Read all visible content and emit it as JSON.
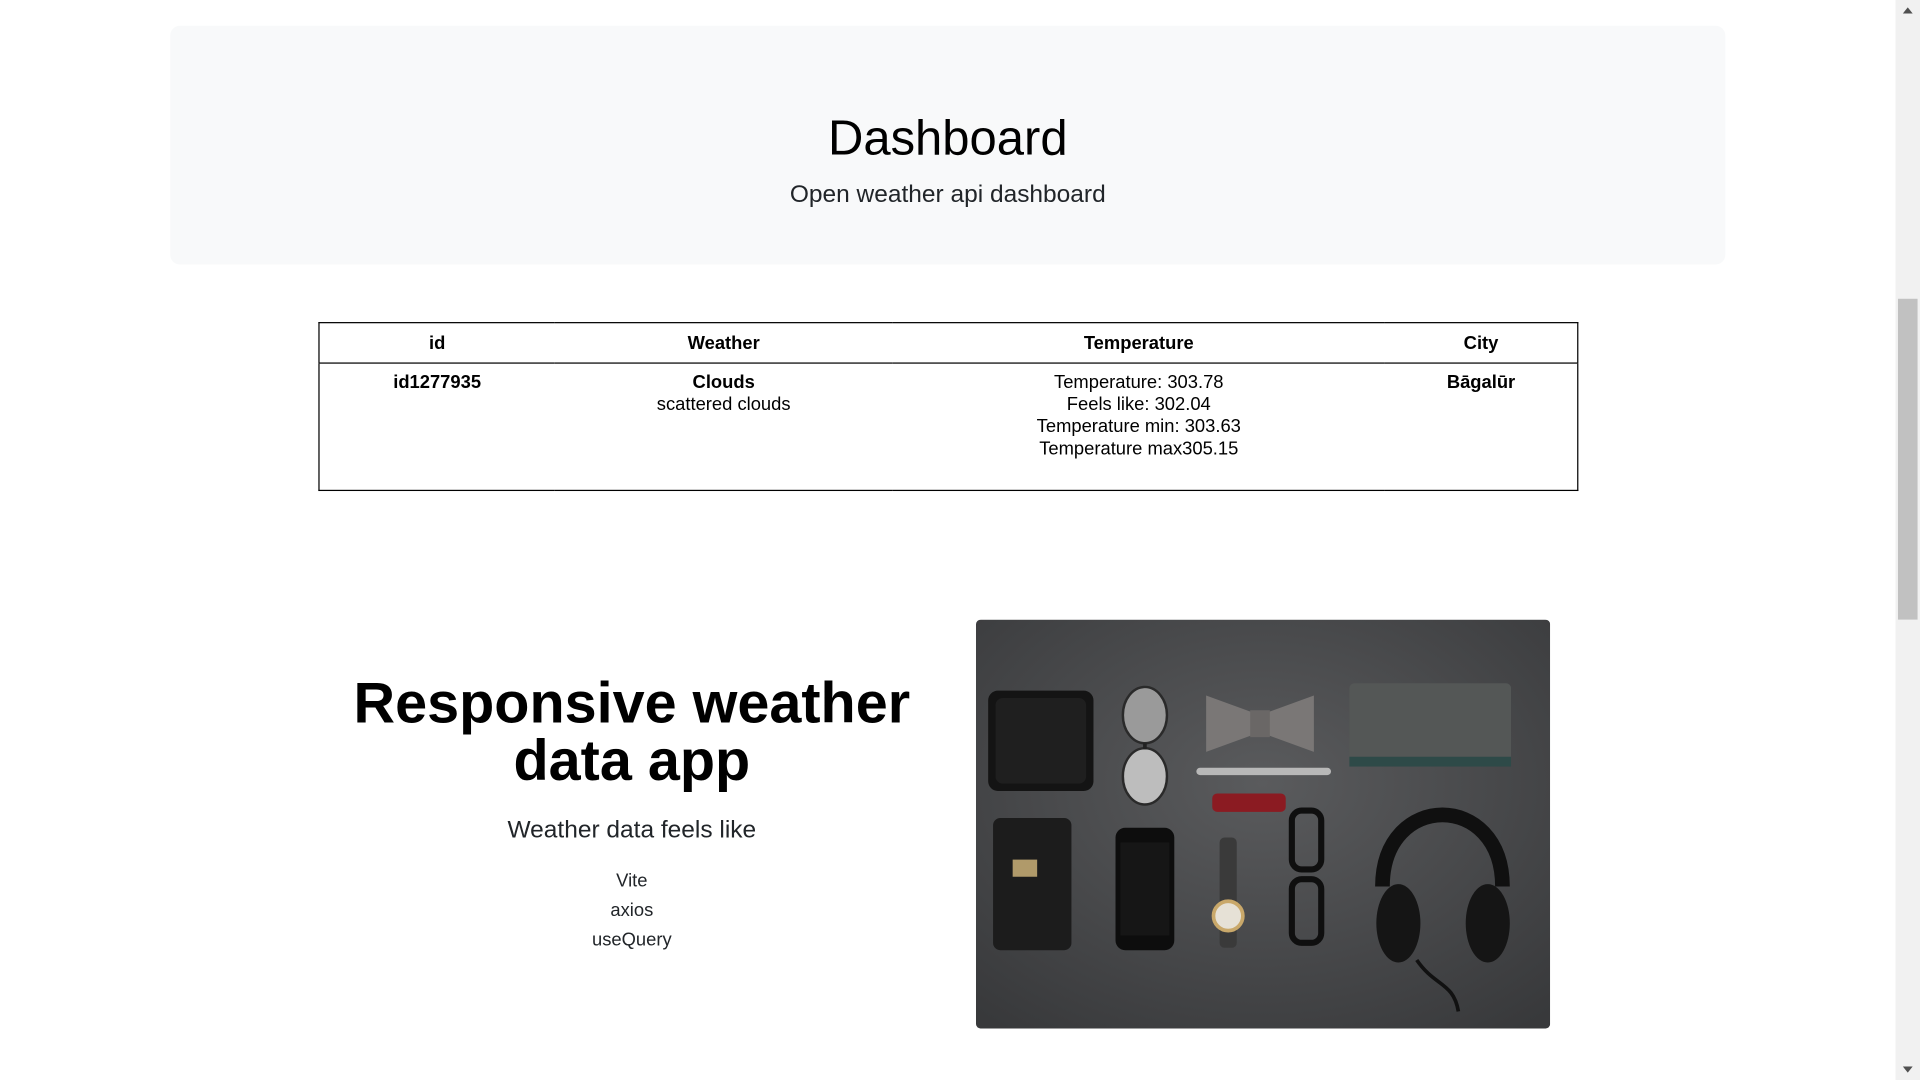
{
  "header": {
    "title": "Dashboard",
    "subtitle": "Open weather api dashboard"
  },
  "table": {
    "columns": [
      "id",
      "Weather",
      "Temperature",
      "City"
    ],
    "rows": [
      {
        "id": "id1277935",
        "weather_main": "Clouds",
        "weather_description": "scattered clouds",
        "temperature": "Temperature: 303.78",
        "feels_like": "Feels like: 302.04",
        "temp_min": "Temperature min: 303.63",
        "temp_max": "Temperature max305.15",
        "city": "Bāgalūr"
      }
    ]
  },
  "feature": {
    "title": "Responsive weather data app",
    "lead": "Weather data feels like",
    "tech": [
      "Vite",
      "axios",
      "useQuery"
    ],
    "image_description": "flat-lay photo of wallet, sunglasses, bow tie, notebook, pen, phone, watch, glasses and headphones on grey background"
  },
  "colors": {
    "hero_background": "#f8f9fa",
    "text": "#212529",
    "table_border": "#000000",
    "photo_background": "#4a4b4d"
  }
}
